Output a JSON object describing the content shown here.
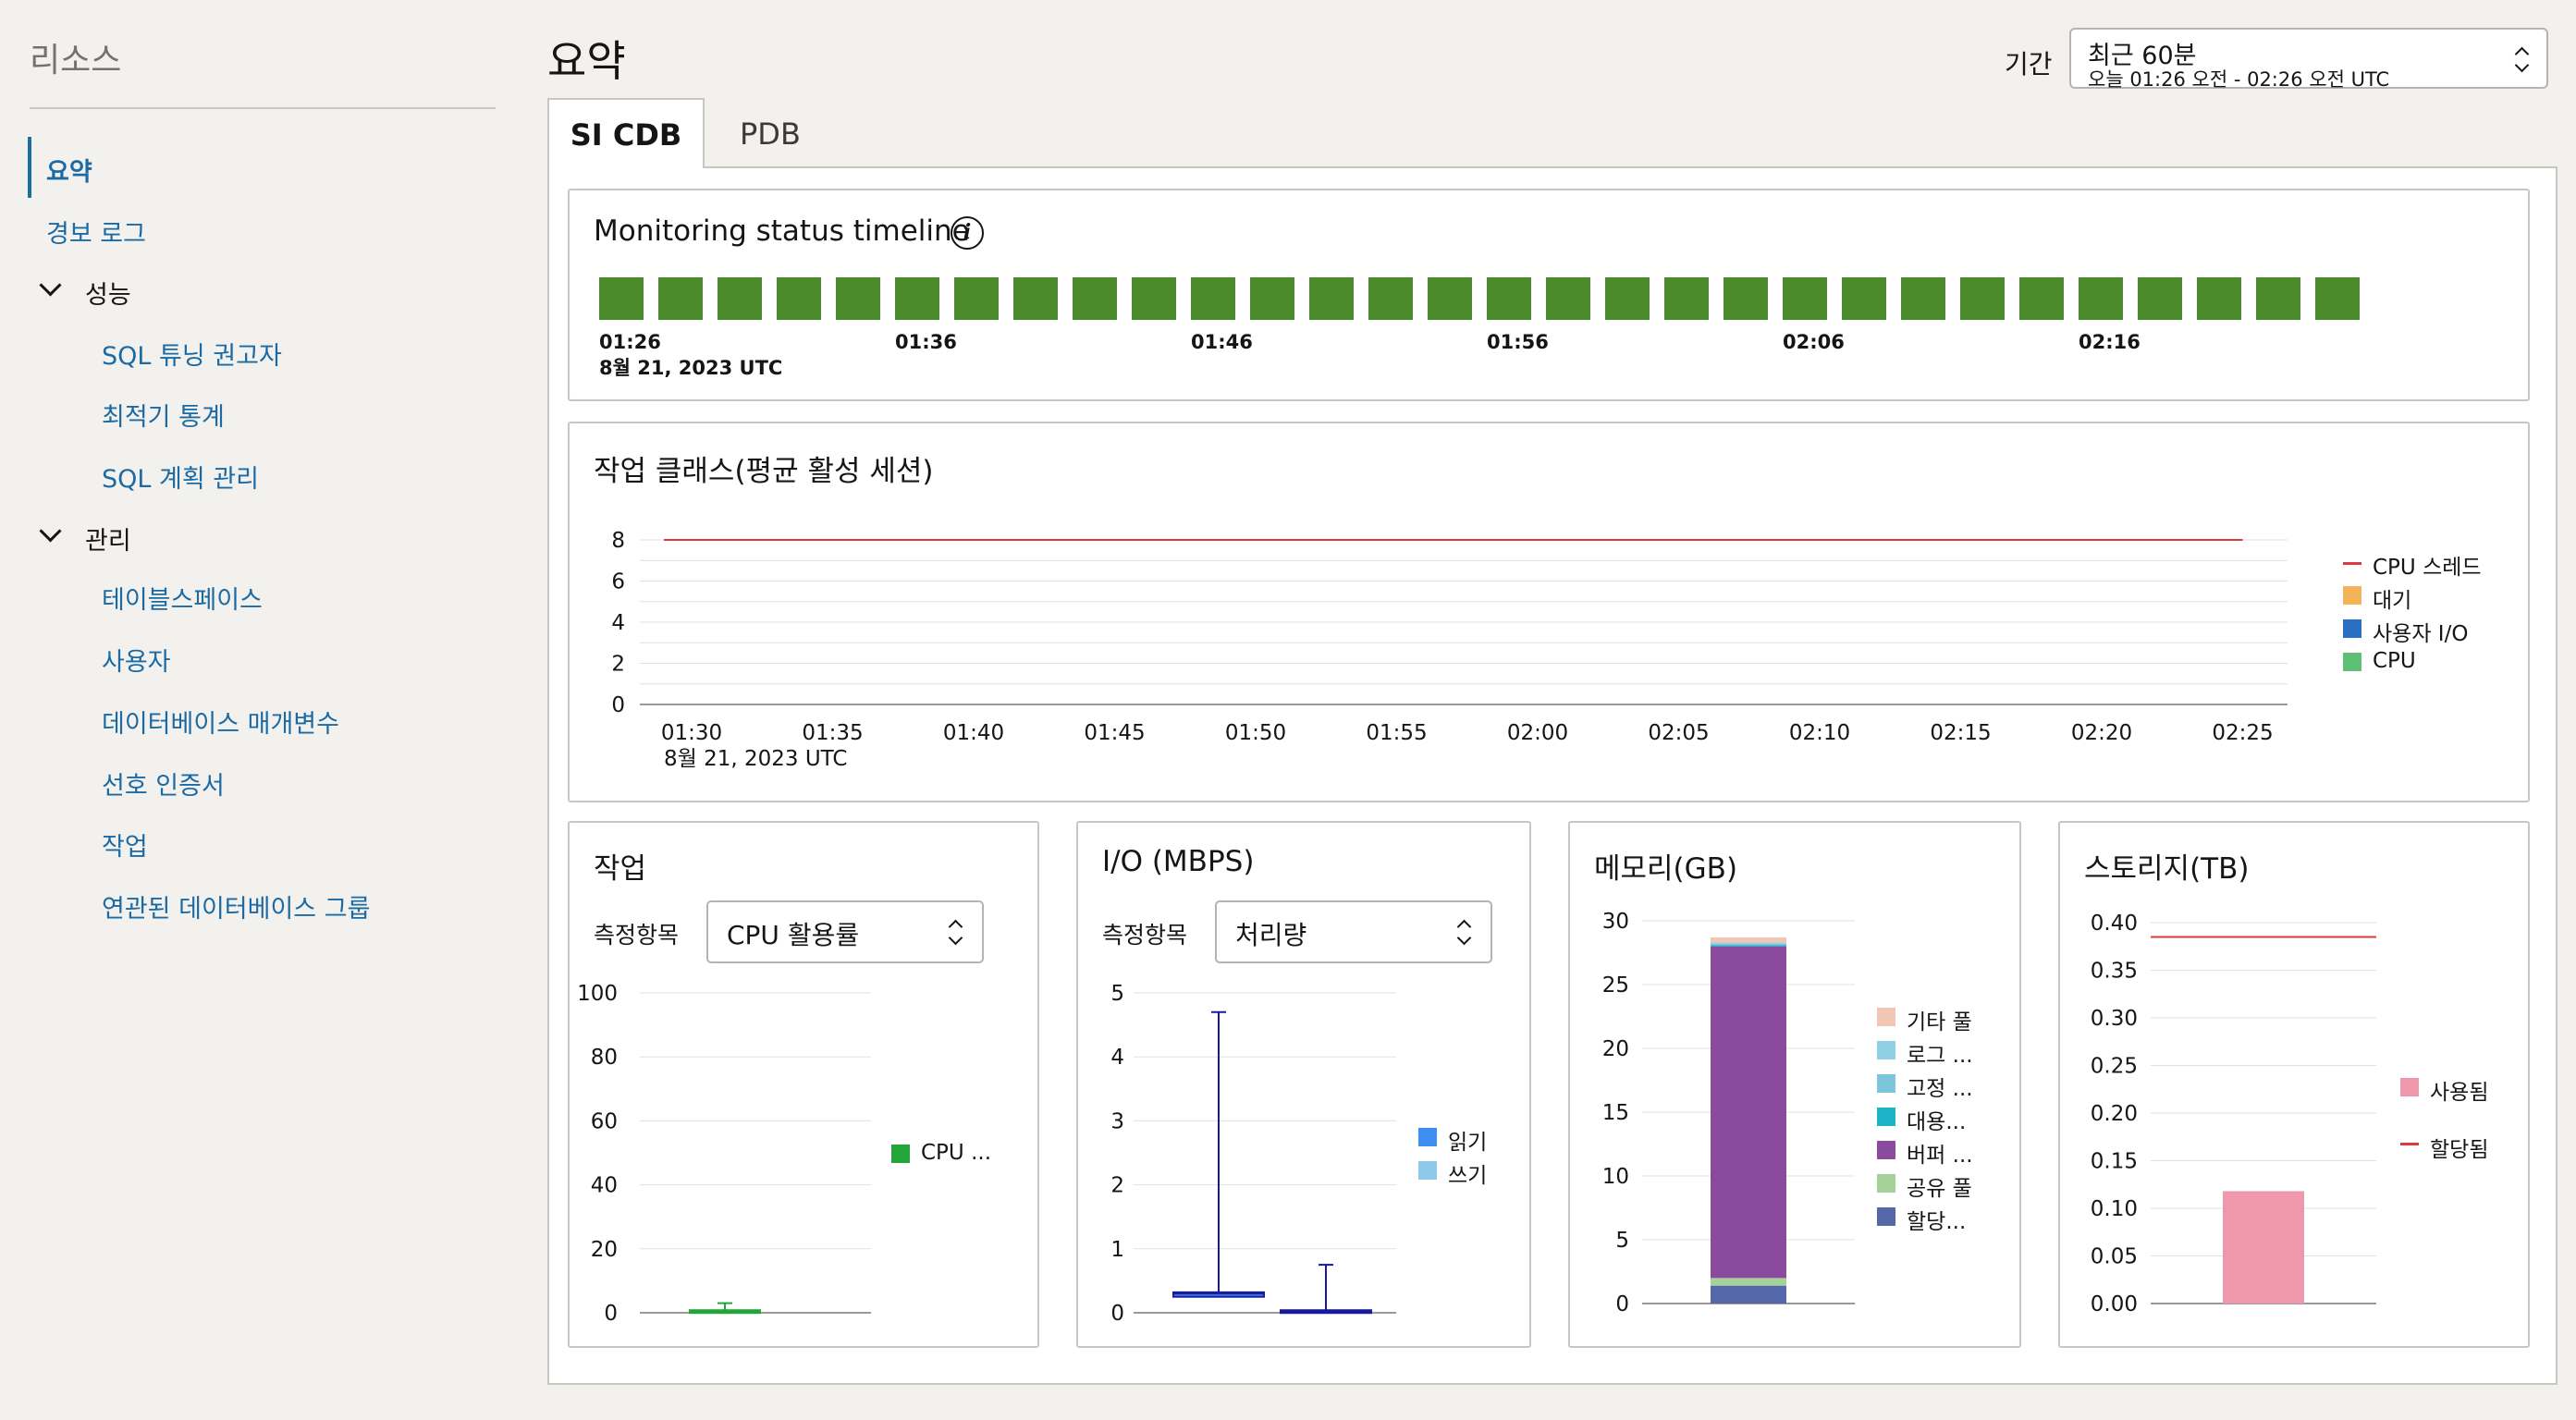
{
  "sidebar": {
    "title": "리소스",
    "items": [
      {
        "label": "요약"
      },
      {
        "label": "경보 로그"
      },
      {
        "label": "성능"
      },
      {
        "label": "SQL 튜닝 권고자"
      },
      {
        "label": "최적기 통계"
      },
      {
        "label": "SQL 계획 관리"
      },
      {
        "label": "관리"
      },
      {
        "label": "테이블스페이스"
      },
      {
        "label": "사용자"
      },
      {
        "label": "데이터베이스 매개변수"
      },
      {
        "label": "선호 인증서"
      },
      {
        "label": "작업"
      },
      {
        "label": "연관된 데이터베이스 그룹"
      }
    ]
  },
  "header": {
    "title": "요약",
    "period_label": "기간",
    "period_value": "최근 60분",
    "period_range": "오늘 01:26 오전 - 02:26 오전 UTC"
  },
  "tabs": [
    {
      "label": "SI CDB"
    },
    {
      "label": "PDB"
    }
  ],
  "timeline": {
    "title": "Monitoring status timeline",
    "status_count": 30,
    "status_color": "#4a8a2a",
    "ticks": [
      "01:26",
      "01:36",
      "01:46",
      "01:56",
      "02:06",
      "02:16"
    ],
    "date": "8월 21, 2023 UTC"
  },
  "colors": {
    "cpu_thread": "#e03b3b",
    "wait": "#f4b35a",
    "user_io": "#2b6fc2",
    "cpu": "#5fbf74",
    "cpu_util": "#22a53a",
    "read": "#3d8ef0",
    "write": "#8ec8ea",
    "memory_other": "#f2c6b4",
    "memory_log": "#8ed0e6",
    "memory_fixed": "#7cc6dc",
    "memory_large": "#1fb3c9",
    "memory_buffer": "#8a4b9e",
    "memory_shared": "#a6d19a",
    "memory_alloc": "#5467a8",
    "storage_used": "#ef98ac",
    "storage_alloc": "#e03b3b"
  },
  "chart_data": [
    {
      "type": "line",
      "title": "작업 클래스(평균 활성 세션)",
      "x": [
        "01:30",
        "01:35",
        "01:40",
        "01:45",
        "01:50",
        "01:55",
        "02:00",
        "02:05",
        "02:10",
        "02:15",
        "02:20",
        "02:25"
      ],
      "x_sub": "8월 21, 2023 UTC",
      "yticks": [
        0,
        2,
        4,
        6,
        8
      ],
      "ylim": [
        0,
        8
      ],
      "series": [
        {
          "name": "CPU 스레드",
          "values": [
            8,
            8,
            8,
            8,
            8,
            8,
            8,
            8,
            8,
            8,
            8,
            8
          ]
        },
        {
          "name": "대기",
          "values": []
        },
        {
          "name": "사용자 I/O",
          "values": []
        },
        {
          "name": "CPU",
          "values": []
        }
      ],
      "legend": "right"
    },
    {
      "type": "boxplot",
      "title": "작업",
      "metric_label": "측정항목",
      "metric_value": "CPU 활용률",
      "yticks": [
        0,
        20,
        40,
        60,
        80,
        100
      ],
      "ylim": [
        0,
        100
      ],
      "series": [
        {
          "name": "CPU ...",
          "min": 0,
          "q1": 0.2,
          "median": 0.5,
          "q3": 0.8,
          "max": 3
        }
      ],
      "legend": "right"
    },
    {
      "type": "boxplot",
      "title": "I/O (MBPS)",
      "metric_label": "측정항목",
      "metric_value": "처리량",
      "yticks": [
        0,
        1,
        2,
        3,
        4,
        5
      ],
      "ylim": [
        0,
        5
      ],
      "series": [
        {
          "name": "읽기",
          "min": 0.25,
          "q1": 0.25,
          "median": 0.3,
          "q3": 0.32,
          "max": 4.7
        },
        {
          "name": "쓰기",
          "min": 0,
          "q1": 0,
          "median": 0.02,
          "q3": 0.04,
          "max": 0.75
        }
      ],
      "legend": "right"
    },
    {
      "type": "bar",
      "stacked": true,
      "title": "메모리(GB)",
      "yticks": [
        0,
        5,
        10,
        15,
        20,
        25,
        30
      ],
      "ylim": [
        0,
        30
      ],
      "series": [
        {
          "name": "할당...",
          "value": 1.4
        },
        {
          "name": "공유 풀",
          "value": 0.6
        },
        {
          "name": "버퍼 ...",
          "value": 26.0
        },
        {
          "name": "대용...",
          "value": 0.1
        },
        {
          "name": "고정 ...",
          "value": 0.1
        },
        {
          "name": "로그 ...",
          "value": 0.1
        },
        {
          "name": "기타 풀",
          "value": 0.4
        }
      ],
      "legend": "right"
    },
    {
      "type": "bar",
      "title": "스토리지(TB)",
      "yticks": [
        "0.00",
        "0.05",
        "0.10",
        "0.15",
        "0.20",
        "0.25",
        "0.30",
        "0.35",
        "0.40"
      ],
      "ylim": [
        0,
        0.4
      ],
      "series": [
        {
          "name": "사용됨",
          "value": 0.118
        },
        {
          "name": "할당됨",
          "value": 0.385
        }
      ],
      "legend": "right"
    }
  ]
}
